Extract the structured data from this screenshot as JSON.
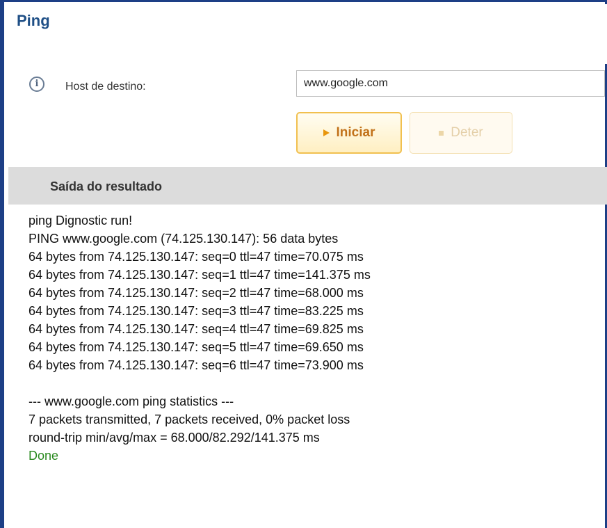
{
  "panel": {
    "title": "Ping"
  },
  "form": {
    "host_label": "Host de destino:",
    "host_value": "www.google.com",
    "start_label": "Iniciar",
    "stop_label": "Deter"
  },
  "result": {
    "header": "Saída do resultado",
    "lines": [
      "ping Dignostic run!",
      "PING www.google.com (74.125.130.147): 56 data bytes",
      "64 bytes from 74.125.130.147: seq=0 ttl=47 time=70.075 ms",
      "64 bytes from 74.125.130.147: seq=1 ttl=47 time=141.375 ms",
      "64 bytes from 74.125.130.147: seq=2 ttl=47 time=68.000 ms",
      "64 bytes from 74.125.130.147: seq=3 ttl=47 time=83.225 ms",
      "64 bytes from 74.125.130.147: seq=4 ttl=47 time=69.825 ms",
      "64 bytes from 74.125.130.147: seq=5 ttl=47 time=69.650 ms",
      "64 bytes from 74.125.130.147: seq=6 ttl=47 time=73.900 ms",
      "",
      "--- www.google.com ping statistics ---",
      "7 packets transmitted, 7 packets received, 0% packet loss",
      "round-trip min/avg/max = 68.000/82.292/141.375 ms"
    ],
    "status": "Done"
  },
  "colors": {
    "frame_border": "#1d3f86",
    "title": "#1f4f86",
    "start_border": "#f1c04f",
    "done_text": "#2a8a1f"
  },
  "icons": {
    "info": "info-icon",
    "start": "play-icon",
    "stop": "stop-icon"
  }
}
